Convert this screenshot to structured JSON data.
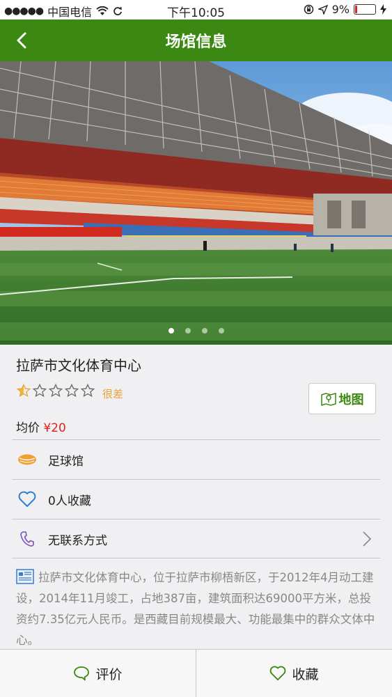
{
  "status_bar": {
    "signal": "●●●●●",
    "carrier": "中国电信",
    "time": "下午10:05",
    "battery": "9%"
  },
  "header": {
    "title": "场馆信息"
  },
  "banner": {
    "page_count": 4,
    "active_page": 1
  },
  "venue": {
    "name": "拉萨市文化体育中心",
    "rating": {
      "stars_filled": 0.5,
      "stars_total": 5,
      "label": "很差"
    },
    "map_button": "地图",
    "price_label": "均价",
    "price_value": "¥20",
    "type": "足球馆",
    "favorites": "0人收藏",
    "contact": "无联系方式",
    "description": "拉萨市文化体育中心，位于拉萨市柳梧新区，于2012年4月动工建设，2014年11月竣工，占地387亩，建筑面积达69000平方米，总投资约7.35亿元人民币。是西藏目前规模最大、功能最集中的群众文体中心。"
  },
  "bottom_bar": {
    "review": "评价",
    "favorite": "收藏"
  },
  "colors": {
    "accent": "#3b8913",
    "price": "#e02020",
    "rating": "#e8a23a",
    "football": "#f0a030",
    "heart": "#2e7fd1",
    "phone": "#7a4fc0"
  }
}
